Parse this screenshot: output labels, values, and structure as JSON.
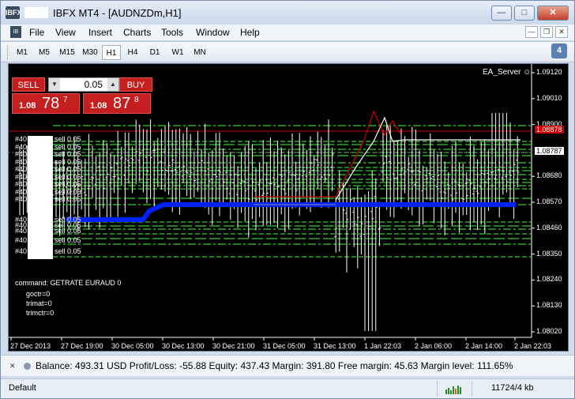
{
  "window": {
    "title": "IBFX MT4 - [AUDNZDm,H1]",
    "app_icon_text": "IBFX",
    "controls": [
      "minimize",
      "maximize",
      "close"
    ]
  },
  "menu": {
    "items": [
      "File",
      "View",
      "Insert",
      "Charts",
      "Tools",
      "Window",
      "Help"
    ]
  },
  "toolbar": {
    "timeframes": [
      "M1",
      "M5",
      "M15",
      "M30",
      "H1",
      "H4",
      "D1",
      "W1",
      "MN"
    ],
    "active_timeframe": "H1",
    "notification_count": "4"
  },
  "trade_panel": {
    "sell_label": "SELL",
    "buy_label": "BUY",
    "lot_value": "0.05",
    "sell_price": {
      "prefix": "1.08",
      "big": "78",
      "sup": "7"
    },
    "buy_price": {
      "prefix": "1.08",
      "big": "87",
      "sup": "8"
    }
  },
  "chart": {
    "ea_label": "EA_Server",
    "ea_icon": "smiley-icon",
    "orders_top": [
      {
        "id": "#40",
        "label": "sell 0.05"
      },
      {
        "id": "#40",
        "label": "sell 0.05"
      },
      {
        "id": "#40",
        "label": "sell 0.05"
      },
      {
        "id": "#40",
        "label": "sell 0.05"
      },
      {
        "id": "#40",
        "label": "sell 0.05"
      },
      {
        "id": "#40",
        "label": "sell 0.05"
      },
      {
        "id": "#40",
        "label": "sell 0.05"
      },
      {
        "id": "#40",
        "label": "sell 0.05"
      },
      {
        "id": "#40",
        "label": "sell 0.05"
      }
    ],
    "orders_bottom": [
      {
        "id": "#40",
        "label": "sell 0.05"
      },
      {
        "id": "#40",
        "label": "sell 0.05"
      },
      {
        "id": "#40",
        "label": "sell 0.05"
      },
      {
        "id": "#40",
        "label": "sell 0.05"
      },
      {
        "id": "#40",
        "label": "sell 0.05"
      }
    ],
    "command_lines": [
      "command: GETRATE EURAUD 0",
      "goctr=0",
      "trimat=0",
      "trimctr=0"
    ],
    "y_axis": [
      "1.09120",
      "1.09010",
      "1.08900",
      "1.08787",
      "1.08680",
      "1.08570",
      "1.08460",
      "1.08350",
      "1.08240",
      "1.08130",
      "1.08020"
    ],
    "bid_label": "1.08787",
    "ask_label": "1.08878",
    "x_axis": [
      "27 Dec 2013",
      "27 Dec 19:00",
      "30 Dec 05:00",
      "30 Dec 13:00",
      "30 Dec 21:00",
      "31 Dec 05:00",
      "31 Dec 13:00",
      "1 Jan 22:03",
      "2 Jan 06:00",
      "2 Jan 14:00",
      "2 Jan 22:03"
    ],
    "colors": {
      "background": "#000000",
      "bars": "#ffffff",
      "order_lines": "#33cc33",
      "ma_line": "#0022ff",
      "ask_line": "#cc0000"
    }
  },
  "account_bar": {
    "text": "Balance: 493.31 USD  Profit/Loss: -55.88  Equity: 437.43  Margin: 391.80  Free margin: 45.63  Margin level: 111.65%"
  },
  "status_bar": {
    "profile": "Default",
    "traffic": "11724/4 kb"
  }
}
